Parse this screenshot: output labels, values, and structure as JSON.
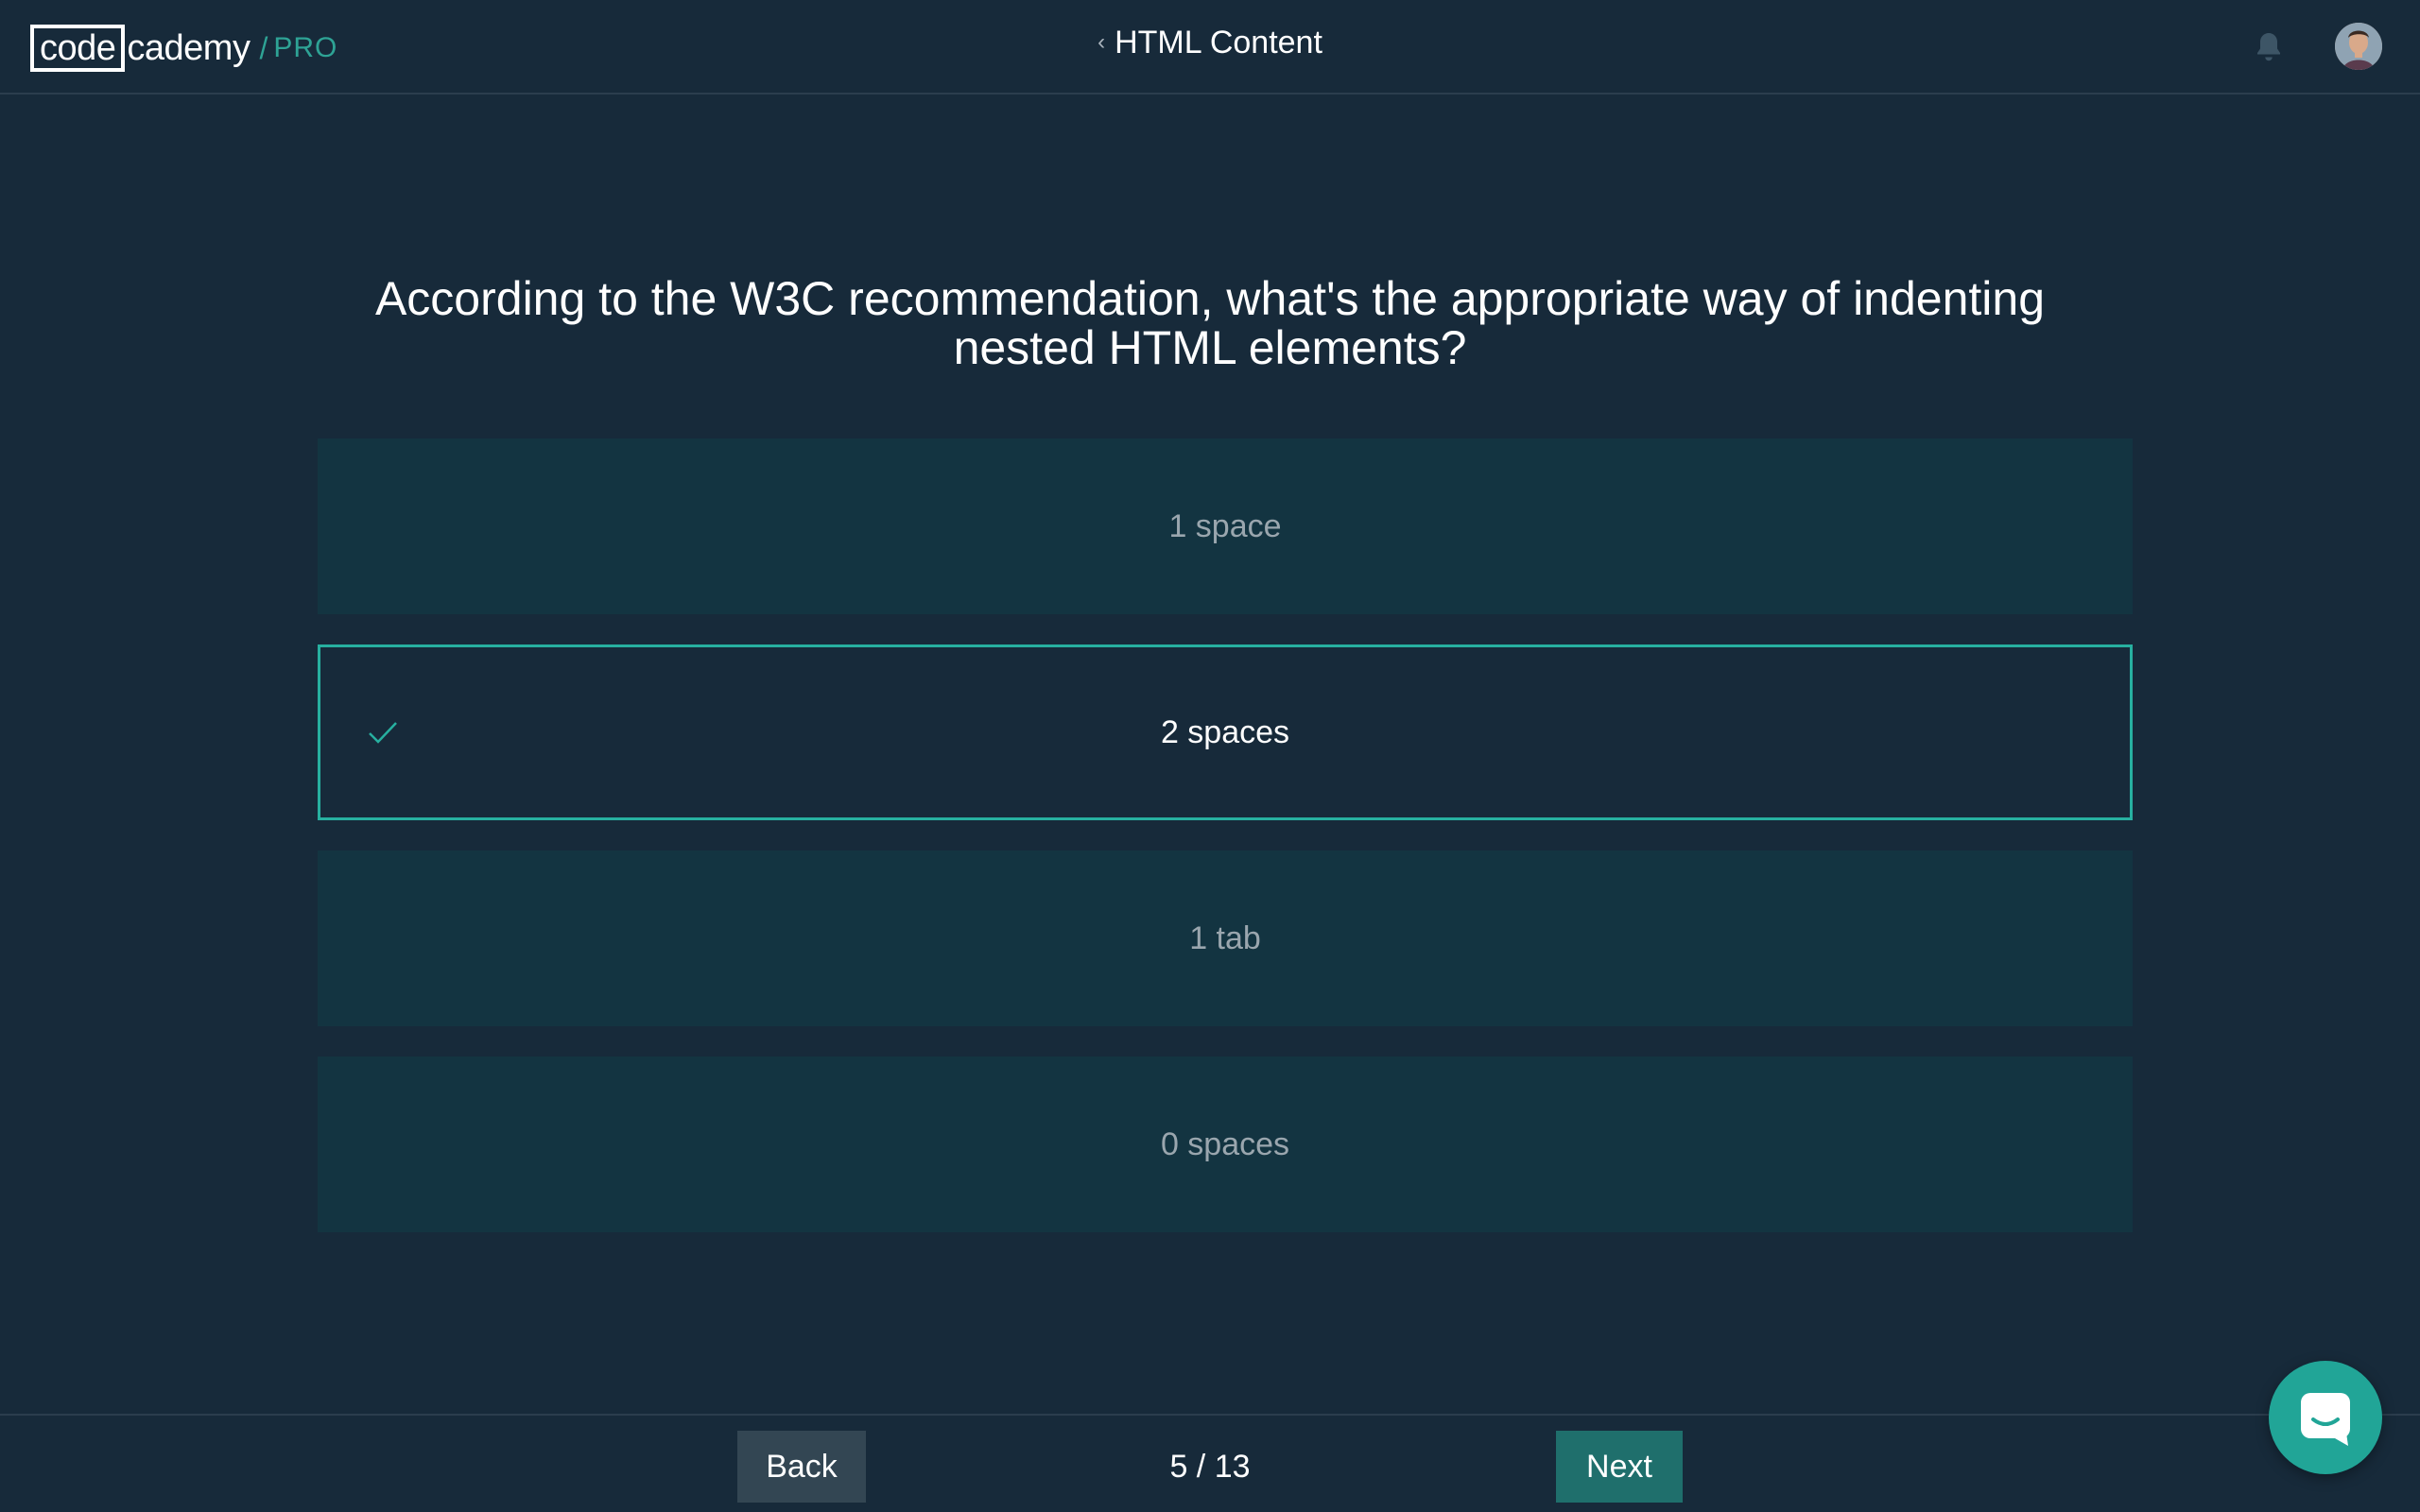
{
  "header": {
    "logo": {
      "code": "code",
      "cademy": "cademy",
      "separator": "/",
      "pro": "PRO"
    },
    "breadcrumb": {
      "chevron_icon": "chevron-left-icon",
      "title": "HTML Content"
    },
    "icons": {
      "notifications": "bell-icon",
      "profile": "avatar"
    }
  },
  "quiz": {
    "question": "According to the W3C recommendation, what's the appropriate way of indenting nested HTML elements?",
    "options": [
      {
        "label": "1 space",
        "selected": false
      },
      {
        "label": "2 spaces",
        "selected": true
      },
      {
        "label": "1 tab",
        "selected": false
      },
      {
        "label": "0 spaces",
        "selected": false
      }
    ]
  },
  "footer": {
    "back_label": "Back",
    "progress": "5 / 13",
    "next_label": "Next"
  },
  "colors": {
    "background": "#172a3a",
    "option_background": "#133441",
    "accent": "#27b0a0",
    "next_button": "#1f6f6c",
    "back_button": "#334653"
  },
  "chat": {
    "icon": "chat-icon"
  }
}
